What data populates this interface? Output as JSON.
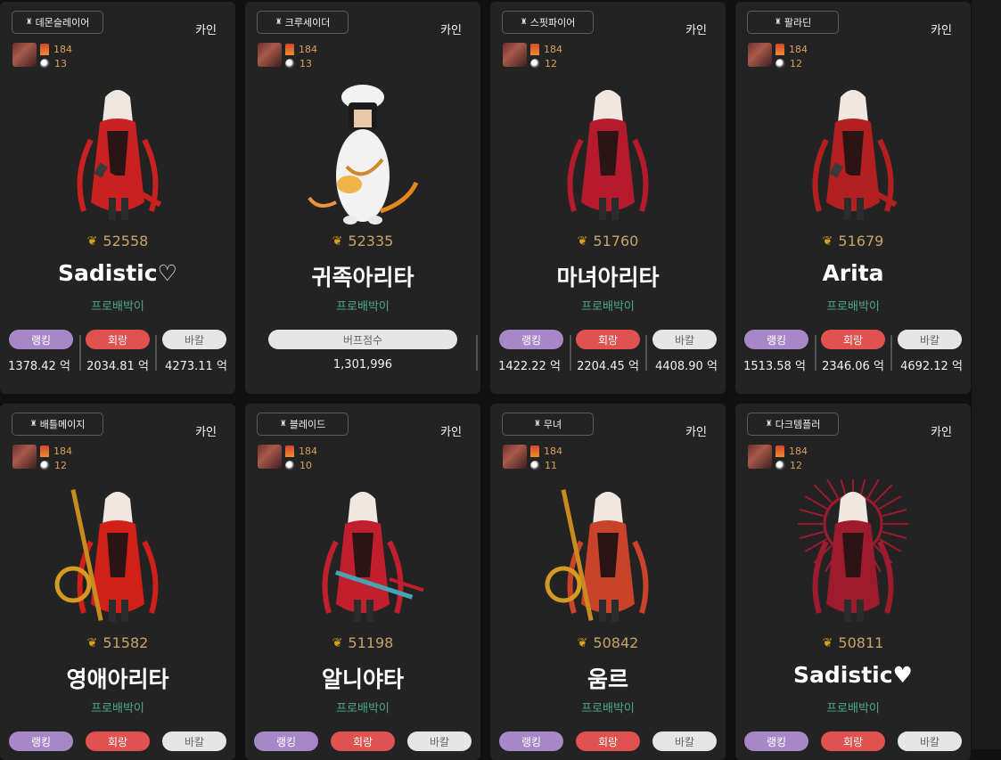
{
  "labels": {
    "ranking": "랭킹",
    "crit": "회랑",
    "bakal": "바칼",
    "buff_score": "버프점수"
  },
  "cards": [
    {
      "job": "데몬슬레이어",
      "server": "카인",
      "level": "184",
      "pet": "13",
      "fame": "52558",
      "name": "Sadistic♡",
      "adventure": "프로배박이",
      "ranking": "1378.42 억",
      "crit": "2034.81 억",
      "bakal": "4273.11 억",
      "accent": "#c8211f",
      "weapon": "sword",
      "type": "dealer"
    },
    {
      "job": "크루세이더",
      "server": "카인",
      "level": "184",
      "pet": "13",
      "fame": "52335",
      "name": "귀족아리타",
      "adventure": "프로배박이",
      "buff": "1,301,996",
      "accent": "#f1f1f1",
      "weapon": "none",
      "type": "buffer"
    },
    {
      "job": "스핏파이어",
      "server": "카인",
      "level": "184",
      "pet": "12",
      "fame": "51760",
      "name": "마녀아리타",
      "adventure": "프로배박이",
      "ranking": "1422.22 억",
      "crit": "2204.45 억",
      "bakal": "4408.90 억",
      "accent": "#b51b2c",
      "weapon": "none",
      "type": "dealer"
    },
    {
      "job": "팔라딘",
      "server": "카인",
      "level": "184",
      "pet": "12",
      "fame": "51679",
      "name": "Arita",
      "adventure": "프로배박이",
      "ranking": "1513.58 억",
      "crit": "2346.06 억",
      "bakal": "4692.12 억",
      "accent": "#b3201f",
      "weapon": "sword",
      "type": "dealer"
    },
    {
      "job": "배틀메이지",
      "server": "카인",
      "level": "184",
      "pet": "12",
      "fame": "51582",
      "name": "영애아리타",
      "adventure": "프로배박이",
      "accent": "#d1201a",
      "weapon": "staff",
      "type": "dealer"
    },
    {
      "job": "블레이드",
      "server": "카인",
      "level": "184",
      "pet": "10",
      "fame": "51198",
      "name": "알니야타",
      "adventure": "프로배박이",
      "accent": "#c21f2e",
      "weapon": "blade",
      "type": "dealer"
    },
    {
      "job": "무녀",
      "server": "카인",
      "level": "184",
      "pet": "11",
      "fame": "50842",
      "name": "움르",
      "adventure": "프로배박이",
      "accent": "#c9432a",
      "weapon": "staff",
      "type": "dealer"
    },
    {
      "job": "다크템플러",
      "server": "카인",
      "level": "184",
      "pet": "12",
      "fame": "50811",
      "name": "Sadistic♥",
      "adventure": "프로배박이",
      "accent": "#9e1a2d",
      "weapon": "halo",
      "type": "dealer"
    }
  ]
}
